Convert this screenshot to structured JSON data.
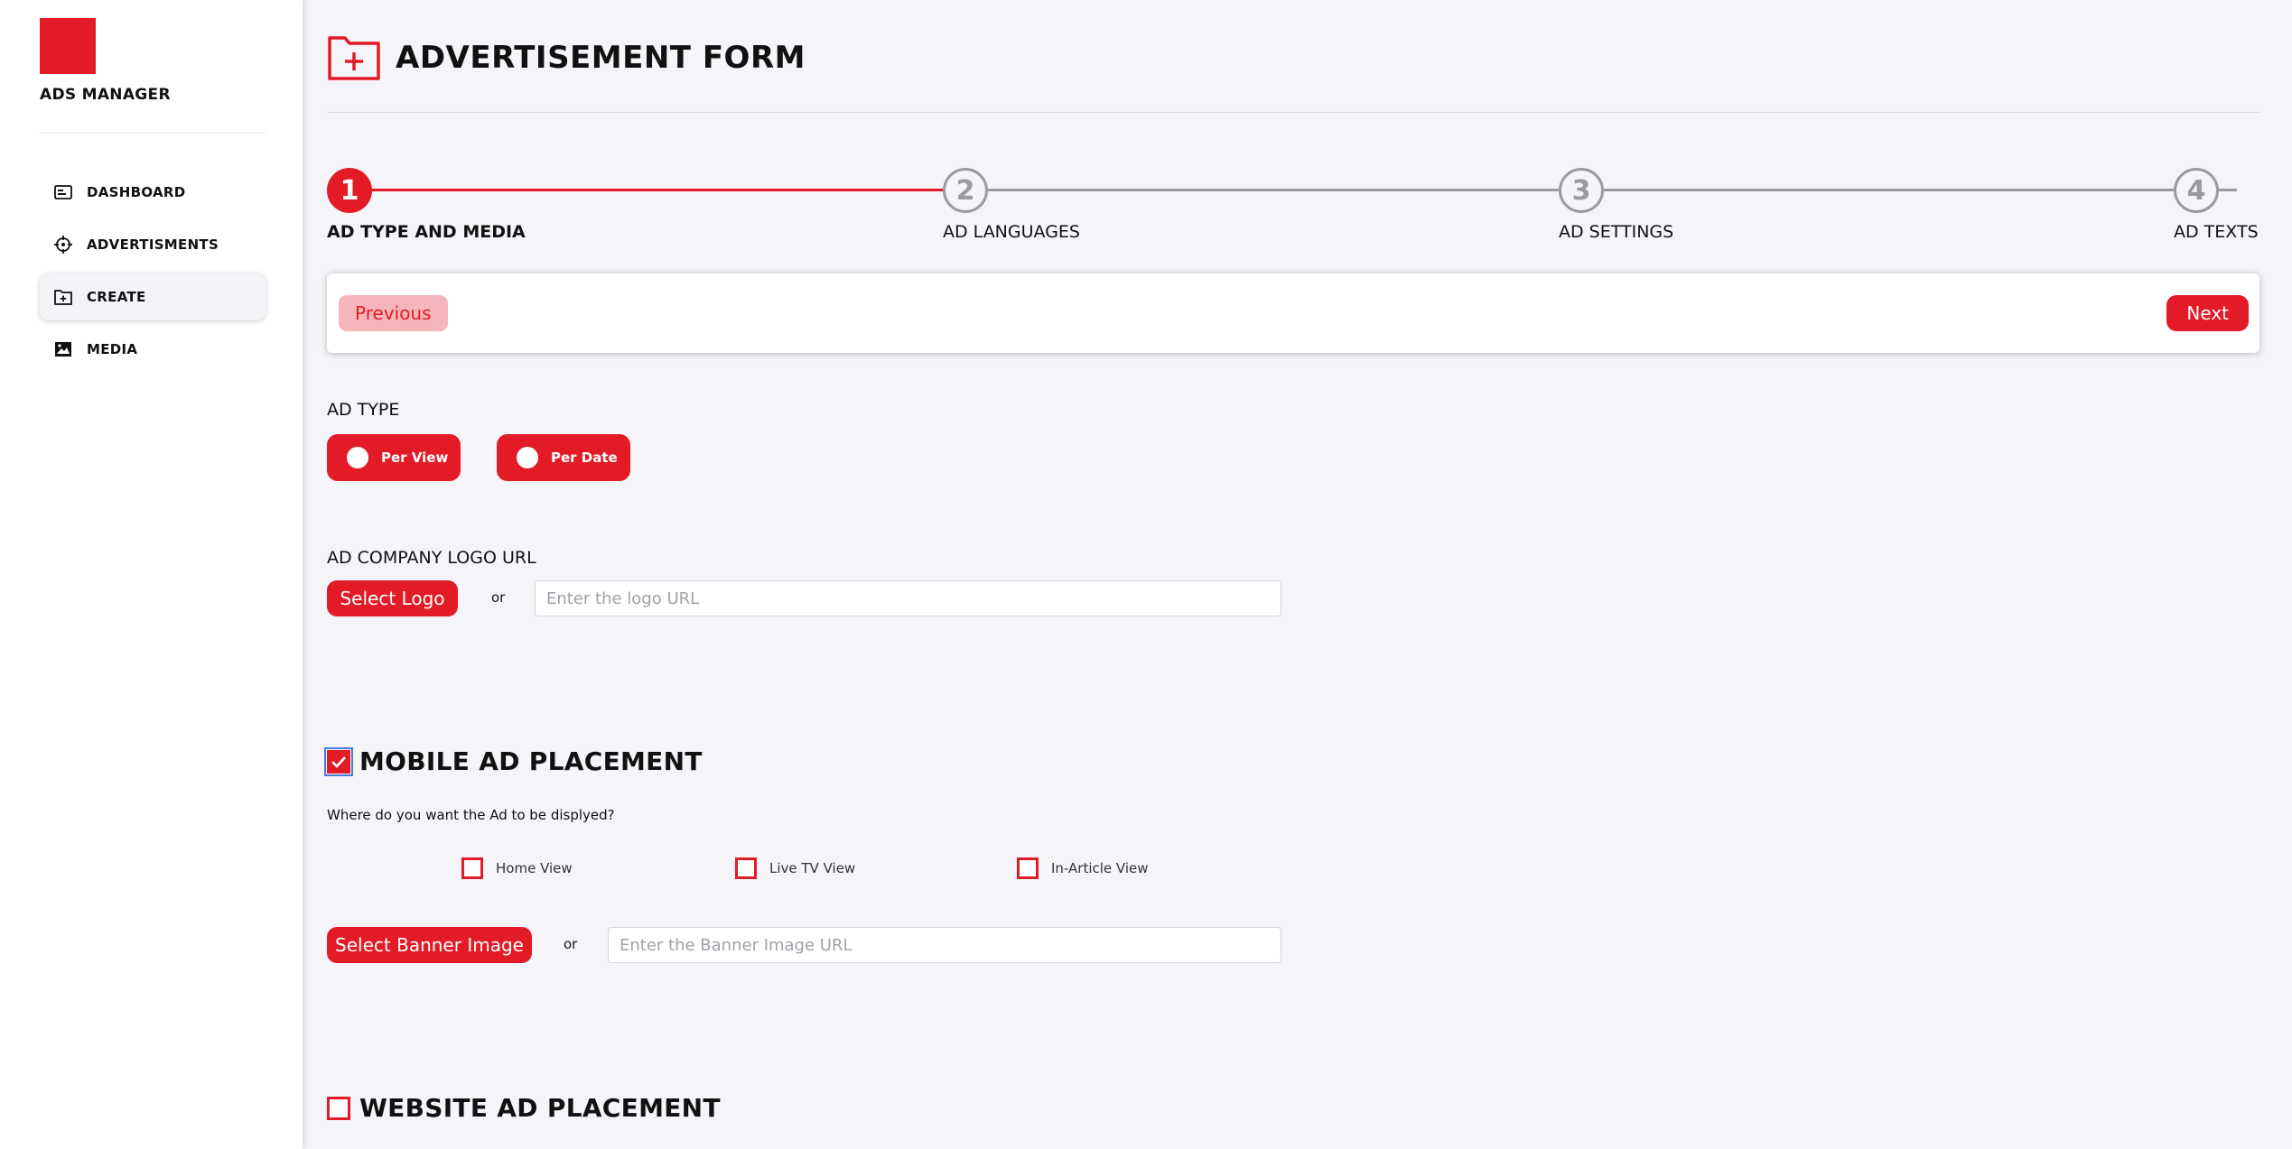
{
  "sidebar": {
    "brand": "ADS MANAGER",
    "items": [
      {
        "label": "DASHBOARD",
        "icon": "dashboard-icon"
      },
      {
        "label": "ADVERTISMENTS",
        "icon": "target-icon"
      },
      {
        "label": "CREATE",
        "icon": "folder-plus-icon",
        "active": true
      },
      {
        "label": "MEDIA",
        "icon": "image-icon"
      }
    ]
  },
  "header": {
    "title": "ADVERTISEMENT FORM",
    "icon": "folder-plus-icon"
  },
  "stepper": {
    "steps": [
      {
        "number": "1",
        "label": "AD TYPE AND MEDIA",
        "status": "current"
      },
      {
        "number": "2",
        "label": "AD LANGUAGES",
        "status": "upcoming"
      },
      {
        "number": "3",
        "label": "AD SETTINGS",
        "status": "upcoming"
      },
      {
        "number": "4",
        "label": "AD TEXTS",
        "status": "upcoming"
      }
    ]
  },
  "nav_buttons": {
    "previous": "Previous",
    "next": "Next"
  },
  "ad_type": {
    "label": "AD TYPE",
    "options": [
      "Per View",
      "Per Date"
    ]
  },
  "logo": {
    "label": "AD COMPANY LOGO URL",
    "button": "Select Logo",
    "or": "or",
    "placeholder": "Enter the logo URL"
  },
  "mobile": {
    "title": "MOBILE AD PLACEMENT",
    "checked": true,
    "question": "Where do you want the Ad to be displyed?",
    "options": [
      "Home View",
      "Live TV View",
      "In-Article View"
    ],
    "button": "Select Banner Image",
    "or": "or",
    "placeholder": "Enter the Banner Image URL"
  },
  "website": {
    "title": "WEBSITE AD PLACEMENT",
    "checked": false
  },
  "colors": {
    "accent": "#e31b26",
    "accent_light": "#f4b6bb",
    "muted": "#9a9aa3"
  }
}
